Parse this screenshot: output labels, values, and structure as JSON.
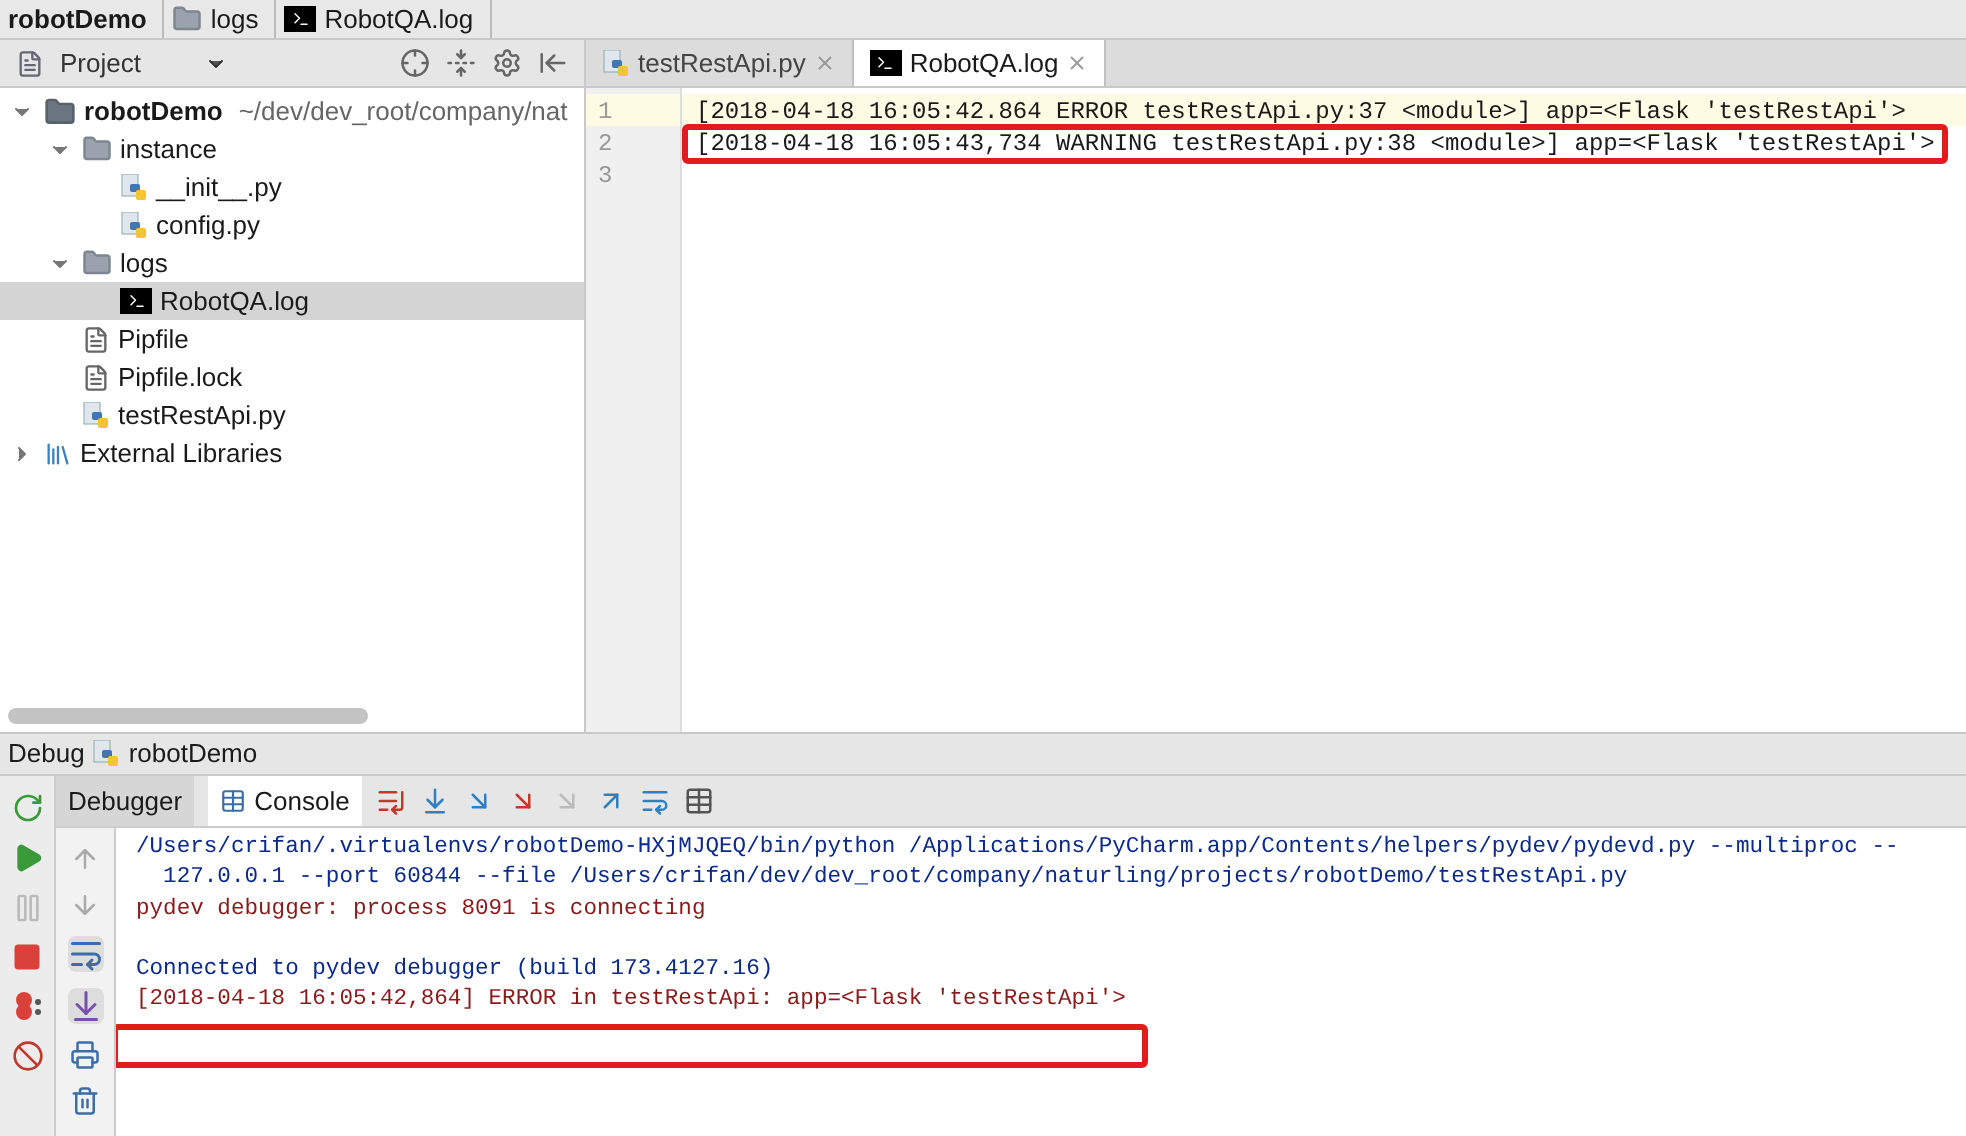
{
  "breadcrumbs": [
    {
      "label": "robotDemo",
      "kind": "project"
    },
    {
      "label": "logs",
      "kind": "folder"
    },
    {
      "label": "RobotQA.log",
      "kind": "log"
    }
  ],
  "project_panel": {
    "title": "Project"
  },
  "tree": [
    {
      "label": "robotDemo",
      "path": "~/dev/dev_root/company/nat",
      "kind": "project",
      "expanded": true,
      "selected": false,
      "children": [
        {
          "label": "instance",
          "kind": "folder",
          "expanded": true,
          "selected": false,
          "children": [
            {
              "label": "__init__.py",
              "kind": "python",
              "selected": false
            },
            {
              "label": "config.py",
              "kind": "python",
              "selected": false
            }
          ]
        },
        {
          "label": "logs",
          "kind": "folder",
          "expanded": true,
          "selected": false,
          "children": [
            {
              "label": "RobotQA.log",
              "kind": "log",
              "selected": true
            }
          ]
        },
        {
          "label": "Pipfile",
          "kind": "text",
          "selected": false
        },
        {
          "label": "Pipfile.lock",
          "kind": "text",
          "selected": false
        },
        {
          "label": "testRestApi.py",
          "kind": "python",
          "selected": false
        }
      ]
    },
    {
      "label": "External Libraries",
      "kind": "library",
      "expanded": false,
      "selected": false
    }
  ],
  "editor_tabs": [
    {
      "label": "testRestApi.py",
      "kind": "python",
      "selected": false
    },
    {
      "label": "RobotQA.log",
      "kind": "log",
      "selected": true
    }
  ],
  "editor_lines": [
    {
      "number": "1",
      "text": "[2018-04-18 16:05:42.864 ERROR testRestApi.py:37 <module>] app=<Flask 'testRestApi'>",
      "current": true,
      "highlighted": false
    },
    {
      "number": "2",
      "text": "[2018-04-18 16:05:43,734 WARNING testRestApi.py:38 <module>] app=<Flask 'testRestApi'>",
      "current": false,
      "highlighted": true
    },
    {
      "number": "3",
      "current": false,
      "highlighted": false
    }
  ],
  "debug": {
    "title": "Debug",
    "config": "robotDemo",
    "tabs": [
      {
        "label": "Debugger",
        "selected": false
      },
      {
        "label": "Console",
        "selected": true
      }
    ],
    "console_lines": [
      {
        "text": "/Users/crifan/.virtualenvs/robotDemo-HXjMJQEQ/bin/python /Applications/PyCharm.app/Contents/helpers/pydev/pydevd.py --multiproc --",
        "kind": "command"
      },
      {
        "text": "  127.0.0.1 --port 60844 --file /Users/crifan/dev/dev_root/company/naturling/projects/robotDemo/testRestApi.py",
        "kind": "command"
      },
      {
        "text": "pydev debugger: process 8091 is connecting",
        "kind": "error"
      },
      {
        "kind": "blank"
      },
      {
        "text": "Connected to pydev debugger (build 173.4127.16)",
        "kind": "command"
      },
      {
        "text": "[2018-04-18 16:05:42,864] ERROR in testRestApi: app=<Flask 'testRestApi'>",
        "kind": "error"
      }
    ],
    "input_highlighted": true
  }
}
